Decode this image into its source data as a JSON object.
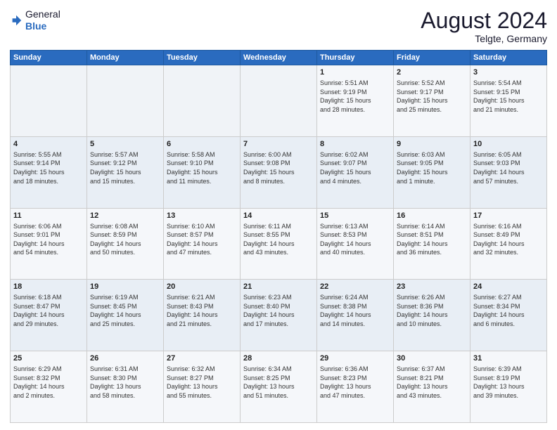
{
  "header": {
    "logo": {
      "general": "General",
      "blue": "Blue"
    },
    "title": "August 2024",
    "location": "Telgte, Germany"
  },
  "calendar": {
    "days_of_week": [
      "Sunday",
      "Monday",
      "Tuesday",
      "Wednesday",
      "Thursday",
      "Friday",
      "Saturday"
    ],
    "weeks": [
      [
        {
          "day": "",
          "info": ""
        },
        {
          "day": "",
          "info": ""
        },
        {
          "day": "",
          "info": ""
        },
        {
          "day": "",
          "info": ""
        },
        {
          "day": "1",
          "info": "Sunrise: 5:51 AM\nSunset: 9:19 PM\nDaylight: 15 hours\nand 28 minutes."
        },
        {
          "day": "2",
          "info": "Sunrise: 5:52 AM\nSunset: 9:17 PM\nDaylight: 15 hours\nand 25 minutes."
        },
        {
          "day": "3",
          "info": "Sunrise: 5:54 AM\nSunset: 9:15 PM\nDaylight: 15 hours\nand 21 minutes."
        }
      ],
      [
        {
          "day": "4",
          "info": "Sunrise: 5:55 AM\nSunset: 9:14 PM\nDaylight: 15 hours\nand 18 minutes."
        },
        {
          "day": "5",
          "info": "Sunrise: 5:57 AM\nSunset: 9:12 PM\nDaylight: 15 hours\nand 15 minutes."
        },
        {
          "day": "6",
          "info": "Sunrise: 5:58 AM\nSunset: 9:10 PM\nDaylight: 15 hours\nand 11 minutes."
        },
        {
          "day": "7",
          "info": "Sunrise: 6:00 AM\nSunset: 9:08 PM\nDaylight: 15 hours\nand 8 minutes."
        },
        {
          "day": "8",
          "info": "Sunrise: 6:02 AM\nSunset: 9:07 PM\nDaylight: 15 hours\nand 4 minutes."
        },
        {
          "day": "9",
          "info": "Sunrise: 6:03 AM\nSunset: 9:05 PM\nDaylight: 15 hours\nand 1 minute."
        },
        {
          "day": "10",
          "info": "Sunrise: 6:05 AM\nSunset: 9:03 PM\nDaylight: 14 hours\nand 57 minutes."
        }
      ],
      [
        {
          "day": "11",
          "info": "Sunrise: 6:06 AM\nSunset: 9:01 PM\nDaylight: 14 hours\nand 54 minutes."
        },
        {
          "day": "12",
          "info": "Sunrise: 6:08 AM\nSunset: 8:59 PM\nDaylight: 14 hours\nand 50 minutes."
        },
        {
          "day": "13",
          "info": "Sunrise: 6:10 AM\nSunset: 8:57 PM\nDaylight: 14 hours\nand 47 minutes."
        },
        {
          "day": "14",
          "info": "Sunrise: 6:11 AM\nSunset: 8:55 PM\nDaylight: 14 hours\nand 43 minutes."
        },
        {
          "day": "15",
          "info": "Sunrise: 6:13 AM\nSunset: 8:53 PM\nDaylight: 14 hours\nand 40 minutes."
        },
        {
          "day": "16",
          "info": "Sunrise: 6:14 AM\nSunset: 8:51 PM\nDaylight: 14 hours\nand 36 minutes."
        },
        {
          "day": "17",
          "info": "Sunrise: 6:16 AM\nSunset: 8:49 PM\nDaylight: 14 hours\nand 32 minutes."
        }
      ],
      [
        {
          "day": "18",
          "info": "Sunrise: 6:18 AM\nSunset: 8:47 PM\nDaylight: 14 hours\nand 29 minutes."
        },
        {
          "day": "19",
          "info": "Sunrise: 6:19 AM\nSunset: 8:45 PM\nDaylight: 14 hours\nand 25 minutes."
        },
        {
          "day": "20",
          "info": "Sunrise: 6:21 AM\nSunset: 8:43 PM\nDaylight: 14 hours\nand 21 minutes."
        },
        {
          "day": "21",
          "info": "Sunrise: 6:23 AM\nSunset: 8:40 PM\nDaylight: 14 hours\nand 17 minutes."
        },
        {
          "day": "22",
          "info": "Sunrise: 6:24 AM\nSunset: 8:38 PM\nDaylight: 14 hours\nand 14 minutes."
        },
        {
          "day": "23",
          "info": "Sunrise: 6:26 AM\nSunset: 8:36 PM\nDaylight: 14 hours\nand 10 minutes."
        },
        {
          "day": "24",
          "info": "Sunrise: 6:27 AM\nSunset: 8:34 PM\nDaylight: 14 hours\nand 6 minutes."
        }
      ],
      [
        {
          "day": "25",
          "info": "Sunrise: 6:29 AM\nSunset: 8:32 PM\nDaylight: 14 hours\nand 2 minutes."
        },
        {
          "day": "26",
          "info": "Sunrise: 6:31 AM\nSunset: 8:30 PM\nDaylight: 13 hours\nand 58 minutes."
        },
        {
          "day": "27",
          "info": "Sunrise: 6:32 AM\nSunset: 8:27 PM\nDaylight: 13 hours\nand 55 minutes."
        },
        {
          "day": "28",
          "info": "Sunrise: 6:34 AM\nSunset: 8:25 PM\nDaylight: 13 hours\nand 51 minutes."
        },
        {
          "day": "29",
          "info": "Sunrise: 6:36 AM\nSunset: 8:23 PM\nDaylight: 13 hours\nand 47 minutes."
        },
        {
          "day": "30",
          "info": "Sunrise: 6:37 AM\nSunset: 8:21 PM\nDaylight: 13 hours\nand 43 minutes."
        },
        {
          "day": "31",
          "info": "Sunrise: 6:39 AM\nSunset: 8:19 PM\nDaylight: 13 hours\nand 39 minutes."
        }
      ]
    ]
  }
}
